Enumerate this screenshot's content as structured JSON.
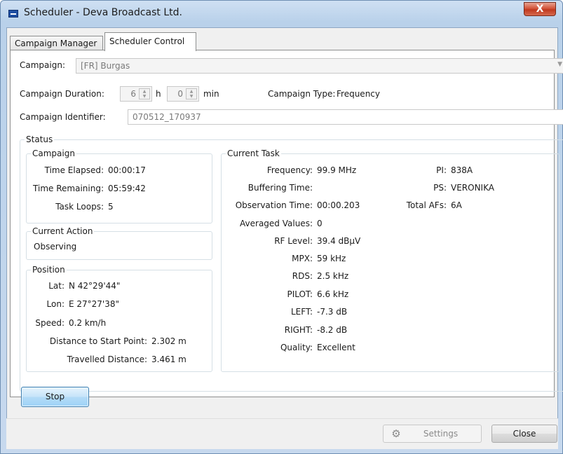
{
  "window": {
    "title": "Scheduler - Deva Broadcast Ltd.",
    "close_glyph": "X"
  },
  "tabs": [
    {
      "label": "Campaign Manager"
    },
    {
      "label": "Scheduler Control"
    }
  ],
  "form": {
    "campaign_label": "Campaign:",
    "campaign_value": "[FR] Burgas",
    "duration_label": "Campaign Duration:",
    "duration_hours": "6",
    "hours_unit": "h",
    "duration_minutes": "0",
    "minutes_unit": "min",
    "type_label": "Campaign Type:",
    "type_value": "Frequency",
    "identifier_label": "Campaign Identifier:",
    "identifier_value": "070512_170937"
  },
  "status": {
    "title": "Status",
    "campaign": {
      "title": "Campaign",
      "time_elapsed_label": "Time Elapsed:",
      "time_elapsed": "00:00:17",
      "time_remaining_label": "Time Remaining:",
      "time_remaining": "05:59:42",
      "task_loops_label": "Task Loops:",
      "task_loops": "5"
    },
    "current_action": {
      "title": "Current Action",
      "value": "Observing"
    },
    "position": {
      "title": "Position",
      "lat_label": "Lat:",
      "lat": "N 42°29'44\"",
      "lon_label": "Lon:",
      "lon": "E 27°27'38\"",
      "speed_label": "Speed:",
      "speed": "0.2 km/h",
      "dist_start_label": "Distance to Start Point:",
      "dist_start": "2.302 m",
      "travelled_label": "Travelled Distance:",
      "travelled": "3.461 m"
    },
    "current_task": {
      "title": "Current Task",
      "frequency_label": "Frequency:",
      "frequency": "99.9 MHz",
      "buffering_label": "Buffering Time:",
      "buffering": "",
      "observation_label": "Observation Time:",
      "observation": "00:00.203",
      "averaged_label": "Averaged Values:",
      "averaged": "0",
      "rf_label": "RF Level:",
      "rf": "39.4 dBµV",
      "mpx_label": "MPX:",
      "mpx": "59 kHz",
      "rds_label": "RDS:",
      "rds": "2.5 kHz",
      "pilot_label": "PILOT:",
      "pilot": "6.6 kHz",
      "left_label": "LEFT:",
      "left": "-7.3 dB",
      "right_label": "RIGHT:",
      "right": "-8.2 dB",
      "quality_label": "Quality:",
      "quality": "Excellent",
      "pi_label": "PI:",
      "pi": "838A",
      "ps_label": "PS:",
      "ps": "VERONIKA",
      "afs_label": "Total AFs:",
      "afs": "6A"
    }
  },
  "buttons": {
    "stop": "Stop",
    "settings": "Settings",
    "close": "Close"
  }
}
